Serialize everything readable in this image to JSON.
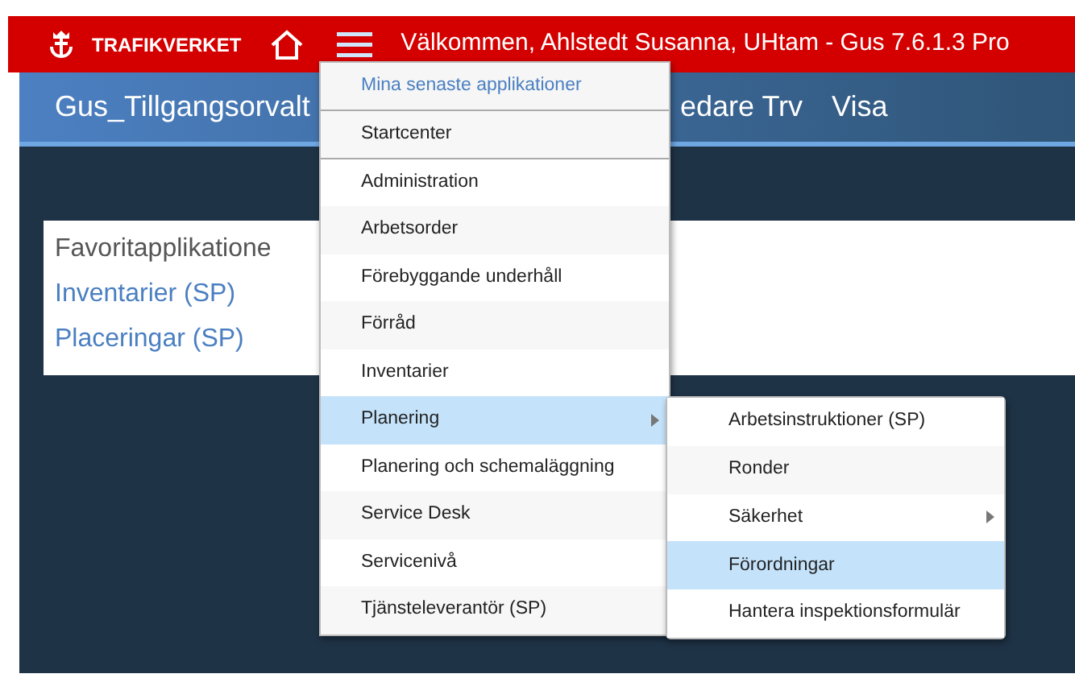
{
  "header": {
    "logo": "TRAFIKVERKET",
    "welcome": "Välkommen, Ahlstedt Susanna, UHtam - Gus 7.6.1.3 Pro"
  },
  "title_bar": {
    "items": [
      "Gus_Tillgangsorvalt",
      "edare Trv",
      "Visa"
    ]
  },
  "favorites": {
    "title": "Favoritapplikatione",
    "links": [
      "Inventarier (SP)",
      "Placeringar (SP)"
    ]
  },
  "app_menu": {
    "recent_label": "Mina senaste applikationer",
    "start": "Startcenter",
    "items": [
      {
        "label": "Administration",
        "selected": false,
        "submenu": false
      },
      {
        "label": "Arbetsorder",
        "selected": false,
        "submenu": false
      },
      {
        "label": "Förebyggande underhåll",
        "selected": false,
        "submenu": false
      },
      {
        "label": "Förråd",
        "selected": false,
        "submenu": false
      },
      {
        "label": "Inventarier",
        "selected": false,
        "submenu": false
      },
      {
        "label": "Planering",
        "selected": true,
        "submenu": true
      },
      {
        "label": "Planering och schemaläggning",
        "selected": false,
        "submenu": false
      },
      {
        "label": "Service Desk",
        "selected": false,
        "submenu": false
      },
      {
        "label": "Servicenivå",
        "selected": false,
        "submenu": false
      },
      {
        "label": "Tjänsteleverantör (SP)",
        "selected": false,
        "submenu": false
      }
    ]
  },
  "submenu": {
    "items": [
      {
        "label": "Arbetsinstruktioner (SP)",
        "selected": false,
        "submenu": false
      },
      {
        "label": "Ronder",
        "selected": false,
        "submenu": false
      },
      {
        "label": "Säkerhet",
        "selected": false,
        "submenu": true
      },
      {
        "label": "Förordningar",
        "selected": true,
        "submenu": false
      },
      {
        "label": "Hantera inspektionsformulär",
        "selected": false,
        "submenu": false
      }
    ]
  }
}
